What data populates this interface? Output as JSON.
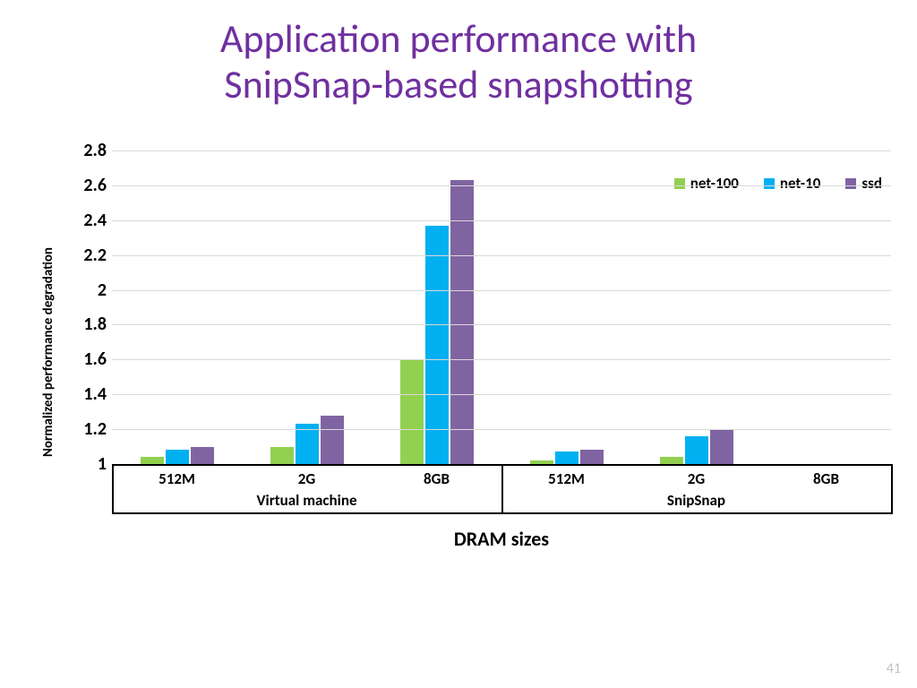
{
  "title_line1": "Application performance with",
  "title_line2": "SnipSnap-based snapshotting",
  "page_number": "41",
  "chart_data": {
    "type": "bar",
    "title": "Application performance with SnipSnap-based snapshotting",
    "ylabel": "Normalized performance degradation",
    "xlabel": "DRAM sizes",
    "ylim": [
      1,
      2.8
    ],
    "yticks": [
      "1",
      "1.2",
      "1.4",
      "1.6",
      "1.8",
      "2",
      "2.2",
      "2.4",
      "2.6",
      "2.8"
    ],
    "groups": [
      "Virtual machine",
      "SnipSnap"
    ],
    "categories_per_group": [
      "512M",
      "2G",
      "8GB"
    ],
    "categories": [
      "VM 512M",
      "VM 2G",
      "VM 8GB",
      "SnipSnap 512M",
      "SnipSnap 2G",
      "SnipSnap 8GB"
    ],
    "series": [
      {
        "name": "net-100",
        "color": "#92D050",
        "values": [
          1.04,
          1.1,
          1.6,
          1.02,
          1.04,
          null
        ]
      },
      {
        "name": "net-10",
        "color": "#00B0F0",
        "values": [
          1.08,
          1.23,
          2.37,
          1.07,
          1.16,
          null
        ]
      },
      {
        "name": "ssd",
        "color": "#8064A2",
        "values": [
          1.1,
          1.28,
          2.63,
          1.08,
          1.2,
          null
        ]
      }
    ]
  }
}
